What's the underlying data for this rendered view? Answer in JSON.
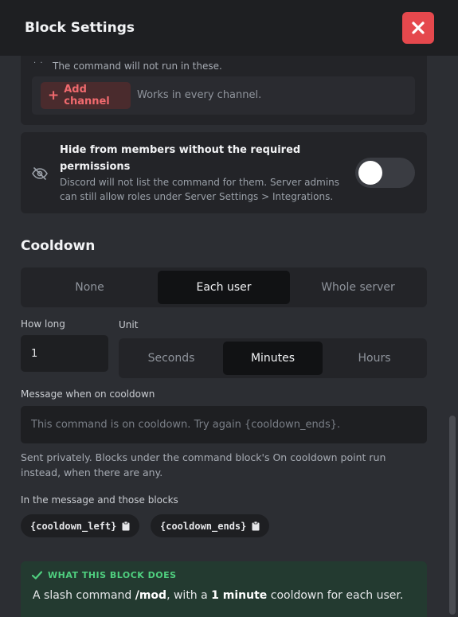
{
  "header": {
    "title": "Block Settings",
    "close_icon": "close-icon"
  },
  "channels": {
    "note": "The command will not run in these.",
    "add_label": "Add channel",
    "hint": "Works in every channel."
  },
  "hide_members": {
    "title": "Hide from members without the required permissions",
    "description": "Discord will not list the command for them. Server admins can still allow roles under Server Settings > Integrations.",
    "enabled": false
  },
  "cooldown": {
    "section_title": "Cooldown",
    "options": [
      "None",
      "Each user",
      "Whole server"
    ],
    "selected": "Each user",
    "how_long_label": "How long",
    "how_long_value": "1",
    "unit_label": "Unit",
    "units": [
      "Seconds",
      "Minutes",
      "Hours"
    ],
    "selected_unit": "Minutes",
    "message_label": "Message when on cooldown",
    "message_placeholder": "This command is on cooldown. Try again {cooldown_ends}.",
    "sent_note": "Sent privately. Blocks under the command block's On cooldown point run instead, when there are any.",
    "vars_label": "In the message and those blocks",
    "variables": [
      "{cooldown_left}",
      "{cooldown_ends}"
    ]
  },
  "summary": {
    "heading": "WHAT THIS BLOCK DOES",
    "text_1": "A slash command ",
    "command": "/mod",
    "text_2": ", with a ",
    "duration": "1 minute",
    "text_3": " cooldown for each user."
  },
  "colors": {
    "danger": "#e5484d",
    "success": "#4fcf7f",
    "background": "#2c2e33"
  }
}
